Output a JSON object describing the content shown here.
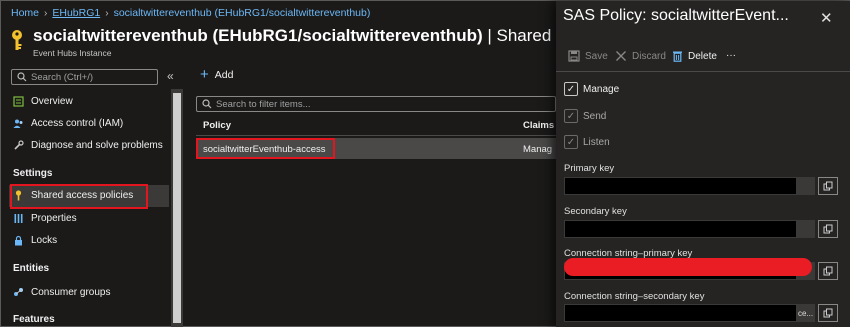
{
  "breadcrumb": {
    "home": "Home",
    "rg": "EHubRG1",
    "current": "socialtwittereventhub (EHubRG1/socialtwittereventhub)"
  },
  "header": {
    "title": "socialtwittereventhub (EHubRG1/socialtwittereventhub)",
    "title_suffix": "| Shared acce",
    "subtitle": "Event Hubs Instance"
  },
  "sidebar": {
    "search_placeholder": "Search (Ctrl+/)",
    "collapse": "«",
    "items": [
      {
        "label": "Overview",
        "icon": "overview-icon"
      },
      {
        "label": "Access control (IAM)",
        "icon": "people-icon"
      },
      {
        "label": "Diagnose and solve problems",
        "icon": "wrench-icon"
      }
    ],
    "section_settings": "Settings",
    "settings_items": [
      {
        "label": "Shared access policies",
        "icon": "key-icon"
      },
      {
        "label": "Properties",
        "icon": "properties-icon"
      },
      {
        "label": "Locks",
        "icon": "lock-icon"
      }
    ],
    "section_entities": "Entities",
    "entities_items": [
      {
        "label": "Consumer groups",
        "icon": "consumer-groups-icon"
      }
    ],
    "section_features": "Features"
  },
  "main": {
    "add_label": "Add",
    "filter_placeholder": "Search to filter items...",
    "columns": [
      "Policy",
      "Claims"
    ],
    "rows": [
      {
        "policy": "socialtwitterEventhub-access",
        "claims": "Manag"
      }
    ]
  },
  "panel": {
    "title": "SAS Policy: socialtwitterEvent...",
    "toolbar": {
      "save": "Save",
      "discard": "Discard",
      "delete": "Delete",
      "more": "···"
    },
    "checkboxes": [
      {
        "label": "Manage",
        "checked": true,
        "enabled": true
      },
      {
        "label": "Send",
        "checked": true,
        "enabled": false
      },
      {
        "label": "Listen",
        "checked": true,
        "enabled": false
      }
    ],
    "fields": [
      {
        "label": "Primary key"
      },
      {
        "label": "Secondary key"
      },
      {
        "label": "Connection string–primary key"
      },
      {
        "label": "Connection string–secondary key",
        "tail": "ce..."
      }
    ]
  },
  "colors": {
    "accent": "#6cb8f6",
    "highlight": "#e3161f",
    "key_yellow": "#f2c12e"
  }
}
